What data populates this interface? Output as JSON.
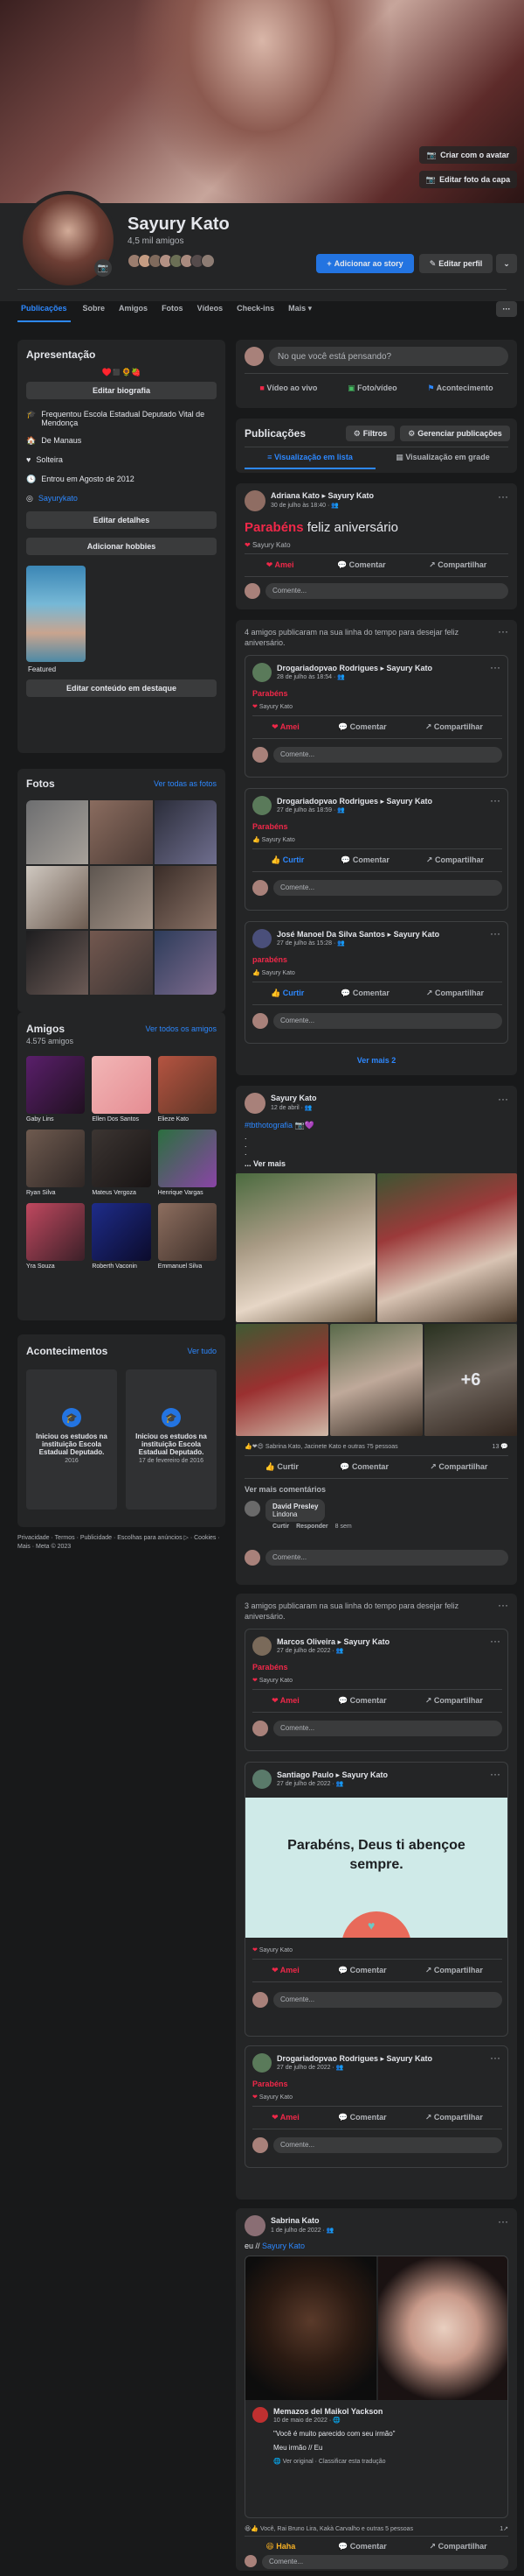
{
  "cover": {
    "btn_avatar": "Criar com o avatar",
    "btn_cover": "Editar foto da capa"
  },
  "profile": {
    "name": "Sayury Kato",
    "friends": "4,5 mil amigos",
    "btn_story": "Adicionar ao story",
    "btn_edit": "Editar perfil"
  },
  "tabs": [
    "Publicações",
    "Sobre",
    "Amigos",
    "Fotos",
    "Vídeos",
    "Check-ins",
    "Mais ▾"
  ],
  "intro": {
    "title": "Apresentação",
    "emojis": "♥️◼️🌻🍓",
    "edit_bio": "Editar biografia",
    "items": [
      {
        "icon": "school-icon",
        "text": "Frequentou Escola Estadual Deputado Vital de Mendonça"
      },
      {
        "icon": "home-icon",
        "text": "De Manaus"
      },
      {
        "icon": "heart-icon",
        "text": "Solteira"
      },
      {
        "icon": "clock-icon",
        "text": "Entrou em Agosto de 2012"
      },
      {
        "icon": "instagram-icon",
        "text": "Sayurykato"
      }
    ],
    "edit_details": "Editar detalhes",
    "add_hobbies": "Adicionar hobbies",
    "featured": "Featured",
    "edit_featured": "Editar conteúdo em destaque"
  },
  "photos": {
    "title": "Fotos",
    "link": "Ver todas as fotos"
  },
  "friends": {
    "title": "Amigos",
    "count": "4.575 amigos",
    "link": "Ver todos os amigos",
    "list": [
      "Gaby Lins",
      "Ellen Dos Santos",
      "Elieze Kato",
      "Ryan Silva",
      "Mateus Vergoza",
      "Henrique Vargas",
      "Yra Souza",
      "Roberth Vaconin",
      "Emmanuel Silva"
    ]
  },
  "events": {
    "title": "Acontecimentos",
    "link": "Ver tudo",
    "list": [
      {
        "text": "Iniciou os estudos na instituição Escola Estadual Deputado.",
        "date": "2016"
      },
      {
        "text": "Iniciou os estudos na instituição Escola Estadual Deputado.",
        "date": "17 de fevereiro de 2016"
      }
    ]
  },
  "footer": "Privacidade · Termos · Publicidade · Escolhas para anúncios ▷ · Cookies · Mais · Meta © 2023",
  "composer": {
    "placeholder": "No que você está pensando?",
    "live": "Vídeo ao vivo",
    "photo": "Foto/vídeo",
    "event": "Acontecimento"
  },
  "posts_header": {
    "title": "Publicações",
    "filters": "Filtros",
    "manage": "Gerenciar publicações",
    "list_view": "Visualização em lista",
    "grid_view": "Visualização em grade"
  },
  "actions": {
    "love": "Amei",
    "comment": "Comentar",
    "share": "Compartilhar",
    "like": "Curtir",
    "haha": "Haha",
    "comment_ph": "Comente..."
  },
  "post1": {
    "author": "Adriana Kato ▸ Sayury Kato",
    "date": "30 de julho às 18:40 · 👥",
    "text_red": "Parabéns",
    "text": "feliz aniversário",
    "reactors": "Sayury Kato"
  },
  "group1": {
    "header": "4 amigos publicaram na sua linha do tempo para desejar feliz aniversário.",
    "posts": [
      {
        "author": "Drogariadopvao Rodrigues ▸ Sayury Kato",
        "date": "28 de julho às 18:54 · 👥",
        "text": "Parabéns",
        "reactors": "Sayury Kato",
        "reaction": "Amei"
      },
      {
        "author": "Drogariadopvao Rodrigues ▸ Sayury Kato",
        "date": "27 de julho às 18:59 · 👥",
        "text": "Parabéns",
        "reactors": "Sayury Kato",
        "reaction": "Curtir"
      },
      {
        "author": "José Manoel Da Silva Santos ▸ Sayury Kato",
        "date": "27 de julho às 15:28 · 👥",
        "text": "parabéns",
        "reactors": "Sayury Kato",
        "reaction": "Curtir"
      }
    ],
    "more": "Ver mais 2"
  },
  "post2": {
    "author": "Sayury Kato",
    "date": "12 de abril · 👥",
    "text": "#tbthotografia 📷💜",
    "dots": ".\n.\n.",
    "more": "... Ver mais",
    "extra": "+6",
    "reactors": "Sabrina Kato, Jacinete Kato e outras 75 pessoas",
    "comments": "13 💬",
    "more_comments": "Ver mais comentários",
    "commenter": "David Presley",
    "comment_text": "Lindona",
    "c_like": "Curtir",
    "c_reply": "Responder",
    "c_time": "8 sem"
  },
  "group2": {
    "header": "3 amigos publicaram na sua linha do tempo para desejar feliz aniversário.",
    "posts": [
      {
        "author": "Marcos Oliveira ▸ Sayury Kato",
        "date": "27 de julho de 2022 · 👥",
        "text": "Parabéns",
        "reactors": "Sayury Kato"
      },
      {
        "author": "Santiago Paulo ▸ Sayury Kato",
        "date": "27 de julho de 2022 · 👥",
        "card_text": "Parabéns, Deus ti abençoe sempre.",
        "reactors": "Sayury Kato"
      },
      {
        "author": "Drogariadopvao Rodrigues ▸ Sayury Kato",
        "date": "27 de julho de 2022 · 👥",
        "text": "Parabéns",
        "reactors": "Sayury Kato"
      }
    ]
  },
  "post3": {
    "author": "Sabrina Kato",
    "date": "1 de julho de 2022 · 👥",
    "text_pre": "eu //",
    "text_link": "Sayury Kato",
    "shared_author": "Memazos del Maikol Yackson",
    "shared_date": "10 de maio de 2022 · 🌐",
    "quote": "\"Você é muito parecido com seu irmão\"",
    "quote2": "Meu irmão // Eu",
    "translate": "🌐 Ver original · Classificar esta tradução",
    "reactors": "Você, Rai Bruno Lira, Kakà Carvalho e outras 5 pessoas",
    "shares": "1↗"
  },
  "colors": {
    "accent": "#2d88ff",
    "red": "#f02849",
    "bg": "#18191a",
    "card": "#242526"
  }
}
